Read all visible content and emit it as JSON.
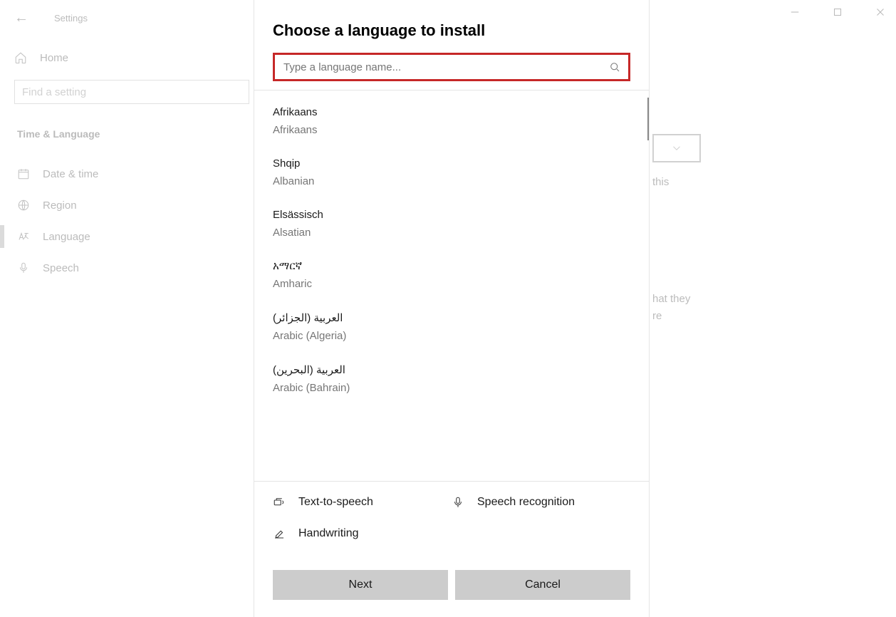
{
  "window": {
    "title": "Settings"
  },
  "sidebar": {
    "home": "Home",
    "search_placeholder": "Find a setting",
    "category": "Time & Language",
    "items": [
      {
        "label": "Date & time"
      },
      {
        "label": "Region"
      },
      {
        "label": "Language"
      },
      {
        "label": "Speech"
      }
    ]
  },
  "background_text": {
    "line1_frag": "this",
    "line2_frag1": "hat they",
    "line2_frag2": "re"
  },
  "dialog": {
    "title": "Choose a language to install",
    "search_placeholder": "Type a language name...",
    "languages": [
      {
        "native": "Afrikaans",
        "english": "Afrikaans"
      },
      {
        "native": "Shqip",
        "english": "Albanian"
      },
      {
        "native": "Elsässisch",
        "english": "Alsatian"
      },
      {
        "native": "አማርኛ",
        "english": "Amharic"
      },
      {
        "native": "العربية (الجزائر)",
        "english": "Arabic (Algeria)"
      },
      {
        "native": "العربية (البحرين)",
        "english": "Arabic (Bahrain)"
      }
    ],
    "features": {
      "tts": "Text-to-speech",
      "speech": "Speech recognition",
      "handwriting": "Handwriting"
    },
    "buttons": {
      "next": "Next",
      "cancel": "Cancel"
    }
  }
}
